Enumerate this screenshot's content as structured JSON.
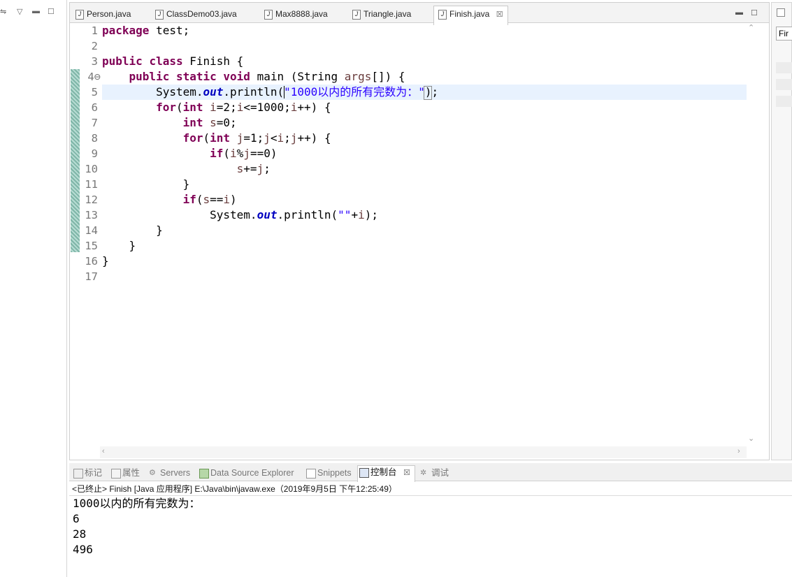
{
  "editor": {
    "tabs": [
      {
        "label": "Person.java"
      },
      {
        "label": "ClassDemo03.java"
      },
      {
        "label": "Max8888.java"
      },
      {
        "label": "Triangle.java"
      },
      {
        "label": "Finish.java",
        "active": true,
        "close": "☒"
      }
    ],
    "line_numbers": [
      "1",
      "2",
      "3",
      "4⊖",
      "5",
      "6",
      "7",
      "8",
      "9",
      "10",
      "11",
      "12",
      "13",
      "14",
      "15",
      "16",
      "17"
    ],
    "code": {
      "l1_kw": "package",
      "l1_rest": " test;",
      "l3_kw1": "public",
      "l3_kw2": "class",
      "l3_rest": " Finish {",
      "l4_indent": "    ",
      "l4_kw1": "public",
      "l4_kw2": "static",
      "l4_kw3": "void",
      "l4_rest1": " main (String ",
      "l4_var": "args",
      "l4_rest2": "[]) {",
      "l5_indent": "        ",
      "l5_a": "System.",
      "l5_fld": "out",
      "l5_b": ".println(",
      "l5_str": "\"1000以内的所有完数为：\"",
      "l5_c": ");",
      "l6_indent": "        ",
      "l6_kw1": "for",
      "l6_a": "(",
      "l6_kw2": "int",
      "l6_b": " ",
      "l6_v1": "i",
      "l6_c": "=2;",
      "l6_v2": "i",
      "l6_d": "<=1000;",
      "l6_v3": "i",
      "l6_e": "++) {",
      "l7_indent": "            ",
      "l7_kw": "int",
      "l7_a": " ",
      "l7_v": "s",
      "l7_b": "=0;",
      "l8_indent": "            ",
      "l8_kw1": "for",
      "l8_a": "(",
      "l8_kw2": "int",
      "l8_b": " ",
      "l8_v1": "j",
      "l8_c": "=1;",
      "l8_v2": "j",
      "l8_d": "<",
      "l8_v3": "i",
      "l8_e": ";",
      "l8_v4": "j",
      "l8_f": "++) {",
      "l9_indent": "                ",
      "l9_kw": "if",
      "l9_a": "(",
      "l9_v1": "i",
      "l9_b": "%",
      "l9_v2": "j",
      "l9_c": "==0)",
      "l10_indent": "                    ",
      "l10_v1": "s",
      "l10_a": "+=",
      "l10_v2": "j",
      "l10_b": ";",
      "l11": "            }",
      "l12_indent": "            ",
      "l12_kw": "if",
      "l12_a": "(",
      "l12_v1": "s",
      "l12_b": "==",
      "l12_v2": "i",
      "l12_c": ")",
      "l13_indent": "                ",
      "l13_a": "System.",
      "l13_fld": "out",
      "l13_b": ".println(",
      "l13_str": "\"\"",
      "l13_c": "+",
      "l13_v": "i",
      "l13_d": ");",
      "l14": "        }",
      "l15": "    }",
      "l16": "}"
    }
  },
  "bottom": {
    "tabs": [
      {
        "label": "标记"
      },
      {
        "label": "属性"
      },
      {
        "label": "Servers"
      },
      {
        "label": "Data Source Explorer"
      },
      {
        "label": "Snippets"
      },
      {
        "label": "控制台",
        "active": true,
        "close": "☒"
      },
      {
        "label": "调试"
      }
    ],
    "status": "<已终止> Finish [Java 应用程序] E:\\Java\\bin\\javaw.exe（2019年9月5日 下午12:25:49）",
    "output": [
      "1000以内的所有完数为：",
      "6",
      "28",
      "496"
    ]
  },
  "right_panel": {
    "field": "Fir"
  },
  "colors": {
    "keyword": "#7f0055",
    "field": "#0000c0",
    "string": "#2a00ff",
    "variable": "#6a3e3e",
    "current_line": "#e8f2fe"
  }
}
